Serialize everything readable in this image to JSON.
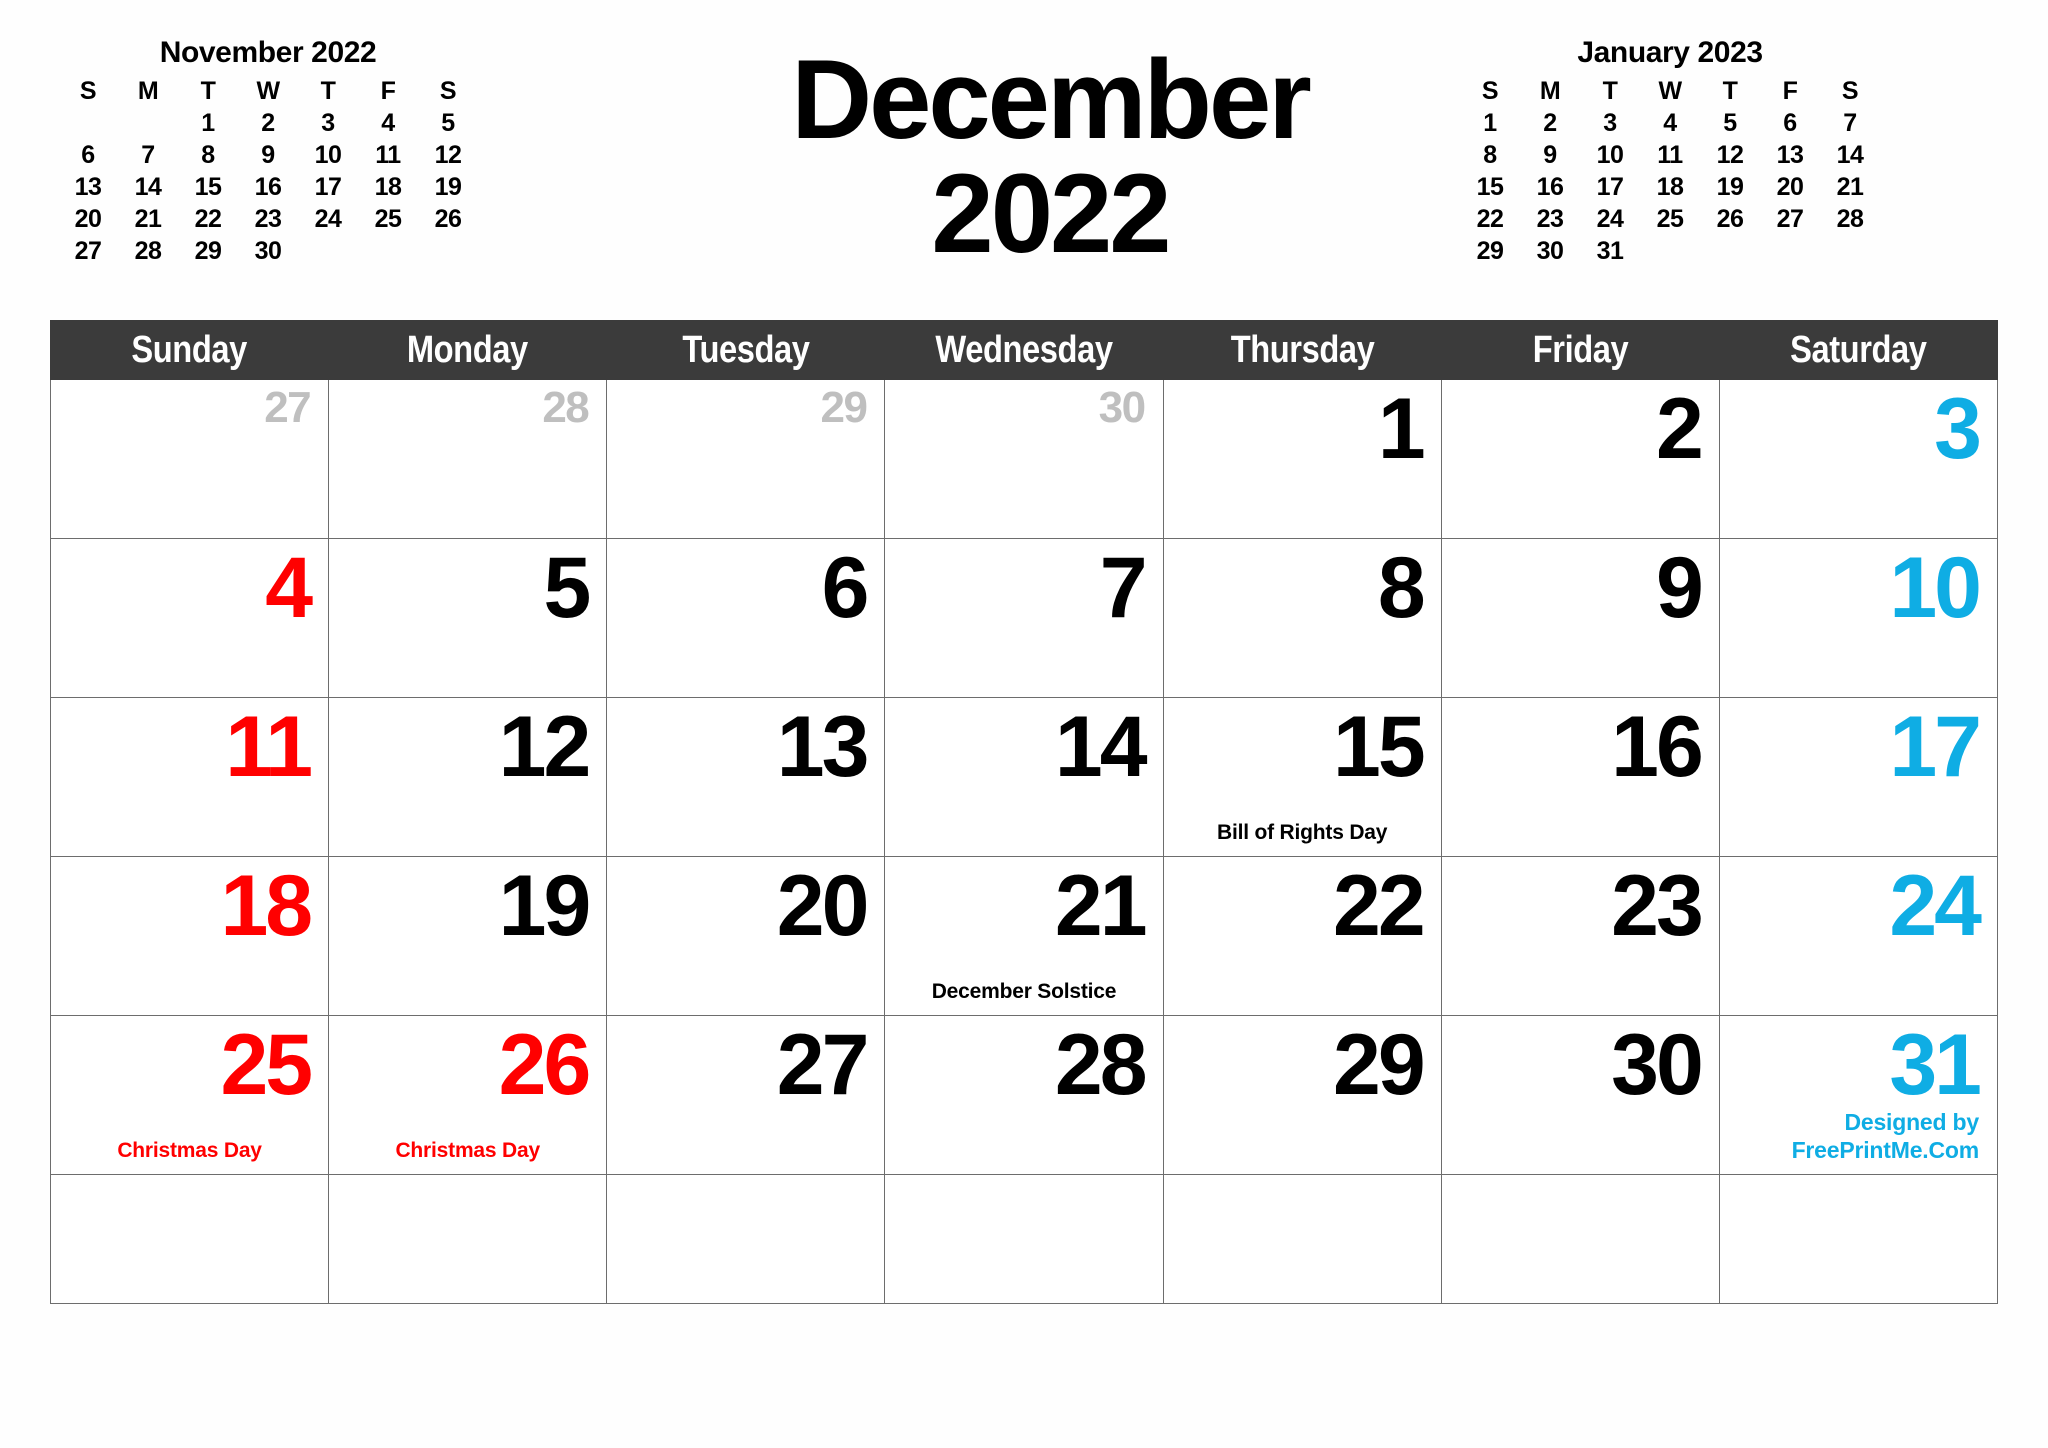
{
  "colors": {
    "sunday": "#ff0000",
    "saturday": "#0fade4",
    "weekday": "#000000",
    "other_month": "#bfbfbf",
    "header_bg": "#3b3b3b",
    "header_text": "#ffffff",
    "grid_line": "#6d6d6d"
  },
  "title": {
    "month": "December",
    "year": "2022"
  },
  "mini_prev": {
    "title": "November 2022",
    "dow": [
      "S",
      "M",
      "T",
      "W",
      "T",
      "F",
      "S"
    ],
    "weeks": [
      [
        "",
        "",
        "1",
        "2",
        "3",
        "4",
        "5"
      ],
      [
        "6",
        "7",
        "8",
        "9",
        "10",
        "11",
        "12"
      ],
      [
        "13",
        "14",
        "15",
        "16",
        "17",
        "18",
        "19"
      ],
      [
        "20",
        "21",
        "22",
        "23",
        "24",
        "25",
        "26"
      ],
      [
        "27",
        "28",
        "29",
        "30",
        "",
        "",
        ""
      ]
    ]
  },
  "mini_next": {
    "title": "January 2023",
    "dow": [
      "S",
      "M",
      "T",
      "W",
      "T",
      "F",
      "S"
    ],
    "weeks": [
      [
        "1",
        "2",
        "3",
        "4",
        "5",
        "6",
        "7"
      ],
      [
        "8",
        "9",
        "10",
        "11",
        "12",
        "13",
        "14"
      ],
      [
        "15",
        "16",
        "17",
        "18",
        "19",
        "20",
        "21"
      ],
      [
        "22",
        "23",
        "24",
        "25",
        "26",
        "27",
        "28"
      ],
      [
        "29",
        "30",
        "31",
        "",
        "",
        "",
        ""
      ]
    ]
  },
  "weekday_headers": [
    "Sunday",
    "Monday",
    "Tuesday",
    "Wednesday",
    "Thursday",
    "Friday",
    "Saturday"
  ],
  "weeks": [
    [
      {
        "num": "27",
        "kind": "other",
        "holiday": "",
        "holiday_color": ""
      },
      {
        "num": "28",
        "kind": "other",
        "holiday": "",
        "holiday_color": ""
      },
      {
        "num": "29",
        "kind": "other",
        "holiday": "",
        "holiday_color": ""
      },
      {
        "num": "30",
        "kind": "other",
        "holiday": "",
        "holiday_color": ""
      },
      {
        "num": "1",
        "kind": "weekday",
        "holiday": "",
        "holiday_color": ""
      },
      {
        "num": "2",
        "kind": "weekday",
        "holiday": "",
        "holiday_color": ""
      },
      {
        "num": "3",
        "kind": "sat",
        "holiday": "",
        "holiday_color": ""
      }
    ],
    [
      {
        "num": "4",
        "kind": "sun",
        "holiday": "",
        "holiday_color": ""
      },
      {
        "num": "5",
        "kind": "weekday",
        "holiday": "",
        "holiday_color": ""
      },
      {
        "num": "6",
        "kind": "weekday",
        "holiday": "",
        "holiday_color": ""
      },
      {
        "num": "7",
        "kind": "weekday",
        "holiday": "",
        "holiday_color": ""
      },
      {
        "num": "8",
        "kind": "weekday",
        "holiday": "",
        "holiday_color": ""
      },
      {
        "num": "9",
        "kind": "weekday",
        "holiday": "",
        "holiday_color": ""
      },
      {
        "num": "10",
        "kind": "sat",
        "holiday": "",
        "holiday_color": ""
      }
    ],
    [
      {
        "num": "11",
        "kind": "sun",
        "holiday": "",
        "holiday_color": ""
      },
      {
        "num": "12",
        "kind": "weekday",
        "holiday": "",
        "holiday_color": ""
      },
      {
        "num": "13",
        "kind": "weekday",
        "holiday": "",
        "holiday_color": ""
      },
      {
        "num": "14",
        "kind": "weekday",
        "holiday": "",
        "holiday_color": ""
      },
      {
        "num": "15",
        "kind": "weekday",
        "holiday": "Bill of Rights Day",
        "holiday_color": "black"
      },
      {
        "num": "16",
        "kind": "weekday",
        "holiday": "",
        "holiday_color": ""
      },
      {
        "num": "17",
        "kind": "sat",
        "holiday": "",
        "holiday_color": ""
      }
    ],
    [
      {
        "num": "18",
        "kind": "sun",
        "holiday": "",
        "holiday_color": ""
      },
      {
        "num": "19",
        "kind": "weekday",
        "holiday": "",
        "holiday_color": ""
      },
      {
        "num": "20",
        "kind": "weekday",
        "holiday": "",
        "holiday_color": ""
      },
      {
        "num": "21",
        "kind": "weekday",
        "holiday": "December Solstice",
        "holiday_color": "black"
      },
      {
        "num": "22",
        "kind": "weekday",
        "holiday": "",
        "holiday_color": ""
      },
      {
        "num": "23",
        "kind": "weekday",
        "holiday": "",
        "holiday_color": ""
      },
      {
        "num": "24",
        "kind": "sat",
        "holiday": "",
        "holiday_color": ""
      }
    ],
    [
      {
        "num": "25",
        "kind": "sun",
        "holiday": "Christmas Day",
        "holiday_color": "red"
      },
      {
        "num": "26",
        "kind": "red",
        "holiday": "Christmas Day",
        "holiday_color": "red"
      },
      {
        "num": "27",
        "kind": "weekday",
        "holiday": "",
        "holiday_color": ""
      },
      {
        "num": "28",
        "kind": "weekday",
        "holiday": "",
        "holiday_color": ""
      },
      {
        "num": "29",
        "kind": "weekday",
        "holiday": "",
        "holiday_color": ""
      },
      {
        "num": "30",
        "kind": "weekday",
        "holiday": "",
        "holiday_color": ""
      },
      {
        "num": "31",
        "kind": "sat",
        "holiday": "",
        "holiday_color": "",
        "credit": true
      }
    ],
    [
      {
        "num": "",
        "kind": "weekday",
        "holiday": "",
        "holiday_color": ""
      },
      {
        "num": "",
        "kind": "weekday",
        "holiday": "",
        "holiday_color": ""
      },
      {
        "num": "",
        "kind": "weekday",
        "holiday": "",
        "holiday_color": ""
      },
      {
        "num": "",
        "kind": "weekday",
        "holiday": "",
        "holiday_color": ""
      },
      {
        "num": "",
        "kind": "weekday",
        "holiday": "",
        "holiday_color": ""
      },
      {
        "num": "",
        "kind": "weekday",
        "holiday": "",
        "holiday_color": ""
      },
      {
        "num": "",
        "kind": "weekday",
        "holiday": "",
        "holiday_color": ""
      }
    ]
  ],
  "credit": {
    "line1": "Designed by",
    "line2": "FreePrintMe.Com"
  }
}
